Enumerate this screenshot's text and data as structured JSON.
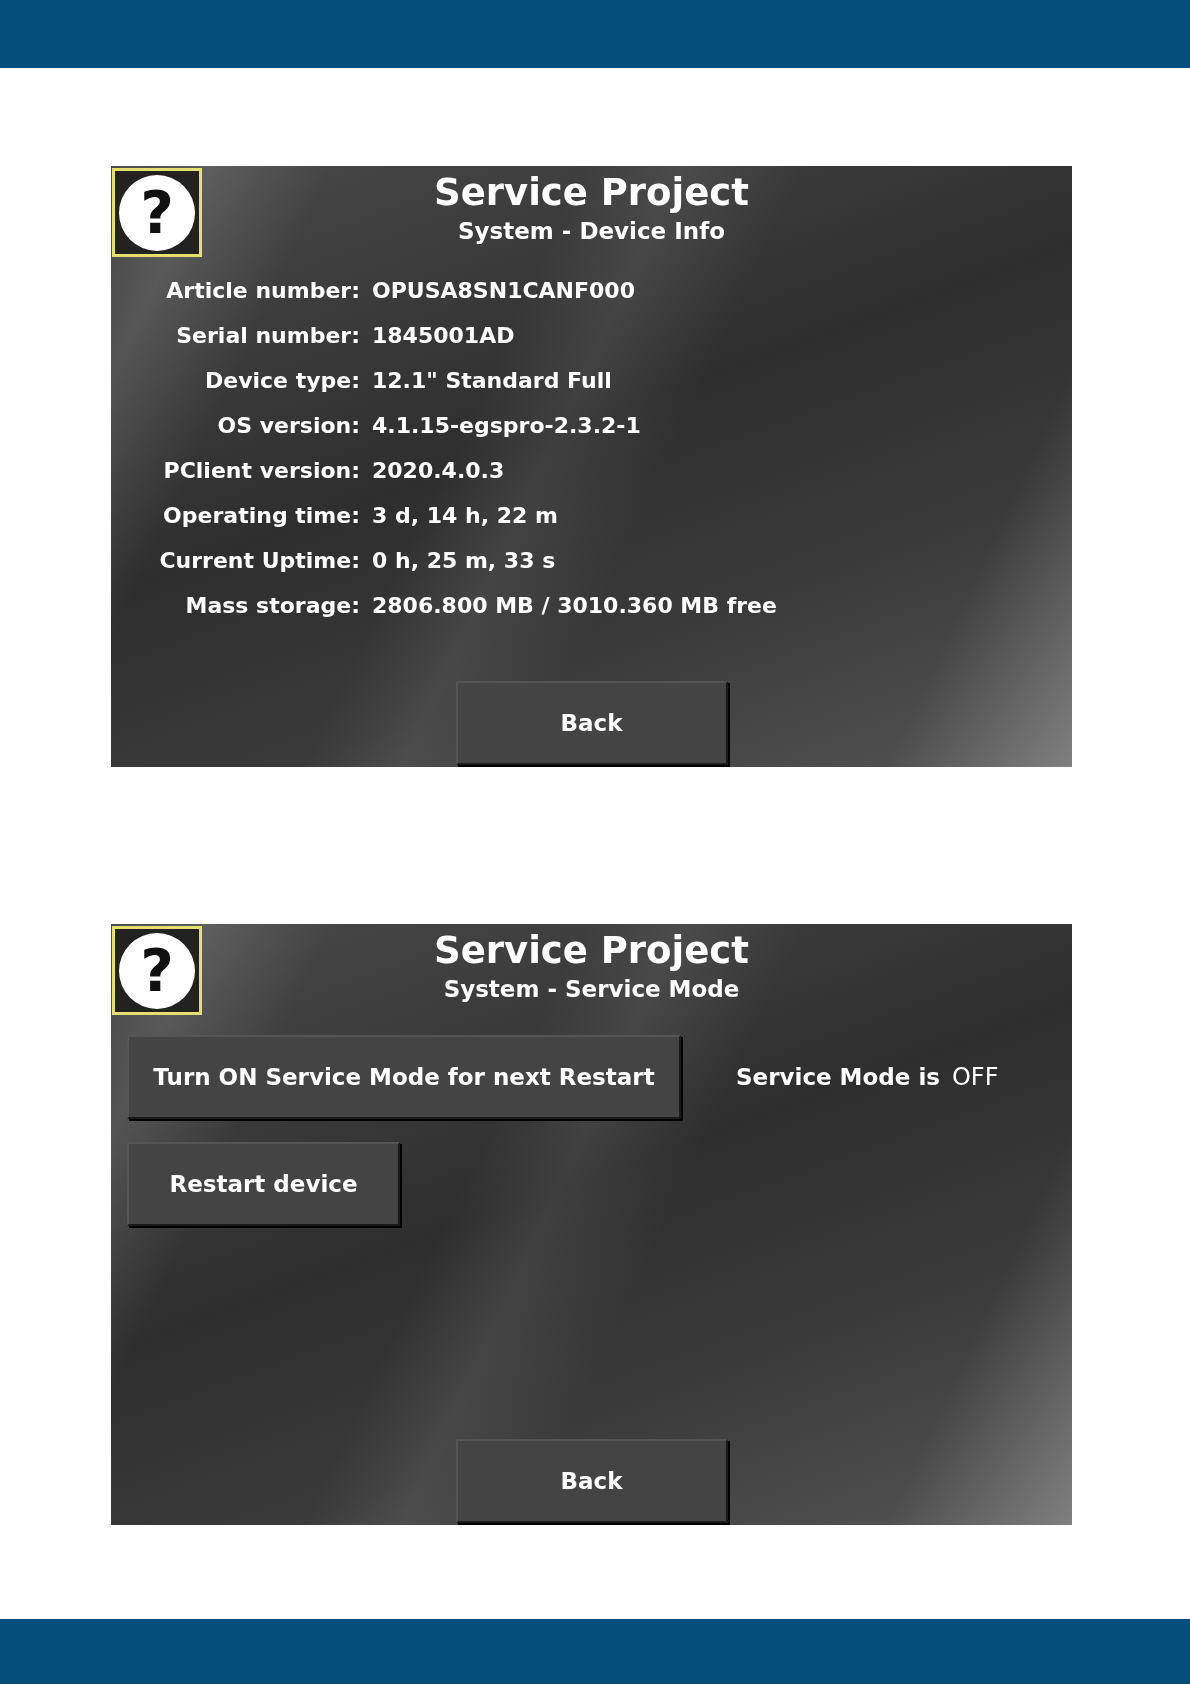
{
  "screens": [
    {
      "kind": "device_info",
      "help_icon": "?",
      "title": "Service Project",
      "subtitle": "System - Device Info",
      "rows": [
        {
          "label": "Article number:",
          "value": "OPUSA8SN1CANF000"
        },
        {
          "label": "Serial number:",
          "value": "1845001AD"
        },
        {
          "label": "Device type:",
          "value": "12.1\" Standard Full"
        },
        {
          "label": "OS version:",
          "value": "4.1.15-egspro-2.3.2-1"
        },
        {
          "label": "PClient version:",
          "value": "2020.4.0.3"
        },
        {
          "label": "Operating time:",
          "value": "3 d, 14 h, 22 m"
        },
        {
          "label": "Current Uptime:",
          "value": "0 h, 25 m, 33 s"
        },
        {
          "label": "Mass storage:",
          "value": "2806.800 MB / 3010.360 MB free"
        }
      ],
      "back_button": "Back"
    },
    {
      "kind": "service_mode",
      "help_icon": "?",
      "title": "Service Project",
      "subtitle": "System - Service Mode",
      "toggle_button": "Turn ON Service Mode for next Restart",
      "status_label": "Service Mode is",
      "status_value": "OFF",
      "restart_button": "Restart device",
      "back_button": "Back"
    }
  ]
}
